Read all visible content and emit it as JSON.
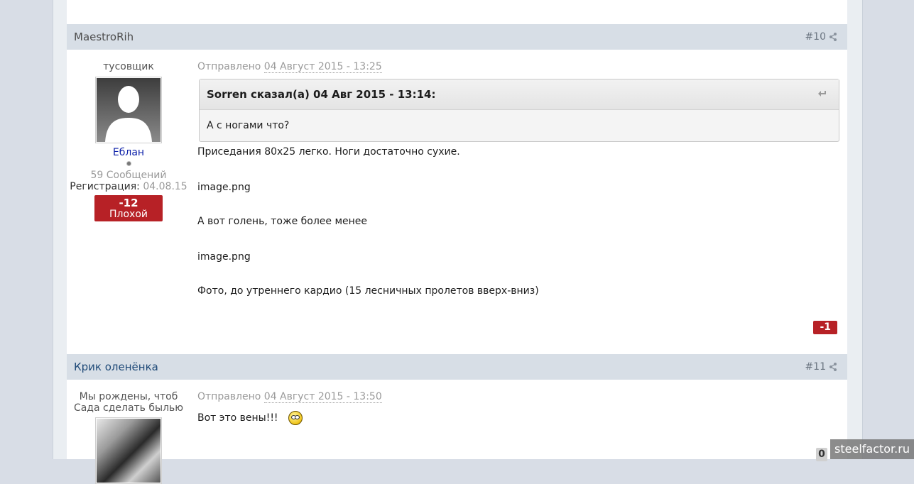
{
  "posts": [
    {
      "author": "MaestroRih",
      "number": "#10",
      "rank": "тусовщик",
      "username": "Еблан",
      "posts_count": "59 Сообщений",
      "reg_label": "Регистрация:",
      "reg_date": "04.08.15",
      "reputation_value": "-12",
      "reputation_label": "Плохой",
      "posted_label": "Отправлено",
      "posted_date": "04 Август 2015 - 13:25",
      "quote_header": "Sorren сказал(а) 04 Авг 2015 - 13:14:",
      "quote_text": "А с ногами что?",
      "paragraphs": [
        "Приседания 80х25 легко. Ноги достаточно сухие.",
        "image.png",
        "А вот голень, тоже более менее",
        "image.png",
        "Фото, до утреннего кардио (15 лесничных пролетов вверх-вниз)"
      ],
      "post_rep": "-1"
    },
    {
      "author": "Крик оленёнка",
      "number": "#11",
      "rank_line1": "Мы рождены, чтоб",
      "rank_line2": "Сада сделать былью",
      "posted_label": "Отправлено",
      "posted_date": "04 Август 2015 - 13:50",
      "text": "Вот это вены!!!",
      "post_rep": "0"
    }
  ],
  "watermark": "steelfactor.ru",
  "icons": {
    "share": "share-icon",
    "quote": "quote-icon",
    "smiley": "smiley-icon"
  }
}
